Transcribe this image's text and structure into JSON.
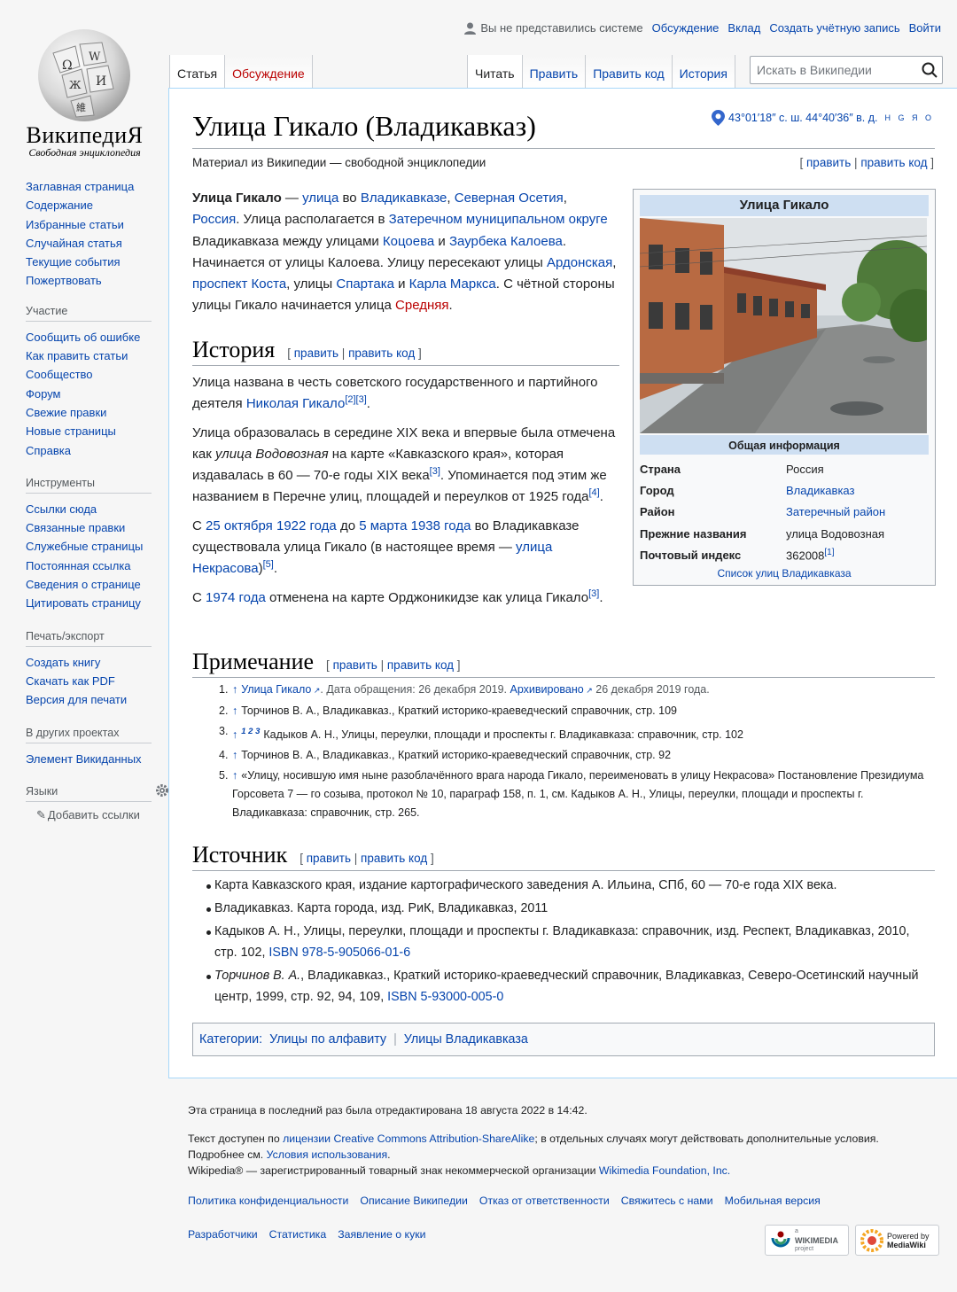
{
  "logo": {
    "wordmark": "ВикипедиЯ",
    "tagline": "Свободная энциклопедия"
  },
  "personal": {
    "anon": "Вы не представились системе",
    "links": [
      "Обсуждение",
      "Вклад",
      "Создать учётную запись",
      "Войти"
    ]
  },
  "tabs": {
    "article": "Статья",
    "talk": "Обсуждение",
    "read": "Читать",
    "edit": "Править",
    "editsource": "Править код",
    "history": "История"
  },
  "search": {
    "placeholder": "Искать в Википедии"
  },
  "sidebar": {
    "nav": [
      "Заглавная страница",
      "Содержание",
      "Избранные статьи",
      "Случайная статья",
      "Текущие события",
      "Пожертвовать"
    ],
    "participation": {
      "title": "Участие",
      "items": [
        "Сообщить об ошибке",
        "Как править статьи",
        "Сообщество",
        "Форум",
        "Свежие правки",
        "Новые страницы",
        "Справка"
      ]
    },
    "tools": {
      "title": "Инструменты",
      "items": [
        "Ссылки сюда",
        "Связанные правки",
        "Служебные страницы",
        "Постоянная ссылка",
        "Сведения о странице",
        "Цитировать страницу"
      ]
    },
    "print": {
      "title": "Печать/экспорт",
      "items": [
        "Создать книгу",
        "Скачать как PDF",
        "Версия для печати"
      ]
    },
    "projects": {
      "title": "В других проектах",
      "items": [
        "Элемент Викиданных"
      ]
    },
    "languages": {
      "title": "Языки",
      "add": "Добавить ссылки"
    }
  },
  "article": {
    "title": "Улица Гикало (Владикавказ)",
    "coords": {
      "text": "43°01′18″ с. ш. 44°40′36″ в. д.",
      "sup": "H G Я O"
    },
    "siteSub": "Материал из Википедии — свободной энциклопедии",
    "edit": {
      "open": "[",
      "edit": "править",
      "sep": "|",
      "editsource": "править код",
      "close": "]"
    },
    "sections": {
      "history": "История",
      "notes": "Примечание",
      "sources": "Источник"
    }
  },
  "infobox": {
    "title": "Улица Гикало",
    "subhead": "Общая информация",
    "rows": [
      {
        "k": "Страна",
        "v": "Россия",
        "link": false
      },
      {
        "k": "Город",
        "v": "Владикавказ",
        "link": true
      },
      {
        "k": "Район",
        "v": "Затеречный район",
        "link": true
      },
      {
        "k": "Прежние названия",
        "v": "улица Водовозная",
        "link": false
      },
      {
        "k": "Почтовый индекс",
        "v": "362008",
        "link": false,
        "ref": "[1]"
      }
    ],
    "footer": "Список улиц Владикавказа"
  },
  "notes": [
    {
      "n": "1.",
      "up": "↑",
      "link": "Улица Гикало",
      "rest1": ". Дата обращения: 26 декабря 2019. ",
      "link2": "Архивировано",
      "rest2": " 26 декабря 2019 года."
    },
    {
      "n": "2.",
      "up": "↑",
      "text": "Торчинов В. А., Владикавказ., Краткий историко-краеведческий справочник, стр. 109"
    },
    {
      "n": "3.",
      "up": "↑",
      "sup": "1 2 3",
      "text": "Кадыков А. Н., Улицы, переулки, площади и проспекты г. Владикавказа: справочник, стр. 102"
    },
    {
      "n": "4.",
      "up": "↑",
      "text": "Торчинов В. А., Владикавказ., Краткий историко-краеведческий справочник, стр. 92"
    },
    {
      "n": "5.",
      "up": "↑",
      "text": "«Улицу, носившую имя ныне разоблачённого врага народа Гикало, переименовать в улицу Некрасова» Постановление Президиума Горсовета 7 — го созыва, протокол № 10, параграф 158, п. 1, см. Кадыков А. Н., Улицы, переулки, площади и проспекты г. Владикавказа: справочник, стр. 265."
    }
  ],
  "sources": [
    {
      "text": "Карта Кавказского края, издание картографического заведения А. Ильина, СПб, 60 — 70-е года XIX века."
    },
    {
      "text": "Владикавказ. Карта города, изд. РиК, Владикавказ, 2011"
    },
    {
      "text": "Кадыков А. Н., Улицы, переулки, площади и проспекты г. Владикавказа: справочник, изд. Респект, Владикавказ, 2010, стр. 102, ",
      "isbn": "ISBN 978-5-905066-01-6"
    },
    {
      "italic": "Торчинов В. А.",
      "text": ", Владикавказ., Краткий историко-краеведческий справочник, Владикавказ, Северо-Осетинский научный центр, 1999, стр. 92, 94, 109, ",
      "isbn": "ISBN 5-93000-005-0"
    }
  ],
  "categories": {
    "label": "Категории:",
    "items": [
      "Улицы по алфавиту",
      "Улицы Владикавказа"
    ]
  },
  "footer": {
    "lastmod": "Эта страница в последний раз была отредактирована 18 августа 2022 в 14:42.",
    "license_pre": "Текст доступен по ",
    "license_link": "лицензии Creative Commons Attribution-ShareAlike",
    "license_post": "; в отдельных случаях могут действовать дополнительные условия.",
    "terms_pre": "Подробнее см. ",
    "terms_link": "Условия использования",
    "terms_post": ".",
    "trademark_pre": "Wikipedia® — зарегистрированный товарный знак некоммерческой организации ",
    "trademark_link": "Wikimedia Foundation, Inc.",
    "links1": [
      "Политика конфиденциальности",
      "Описание Википедии",
      "Отказ от ответственности",
      "Свяжитесь с нами",
      "Мобильная версия"
    ],
    "links2": [
      "Разработчики",
      "Статистика",
      "Заявление о куки"
    ],
    "badge1": {
      "top": "a",
      "main": "WIKIMEDIA",
      "sub": "project"
    },
    "badge2": {
      "top": "Powered by",
      "main": "MediaWiki"
    }
  }
}
